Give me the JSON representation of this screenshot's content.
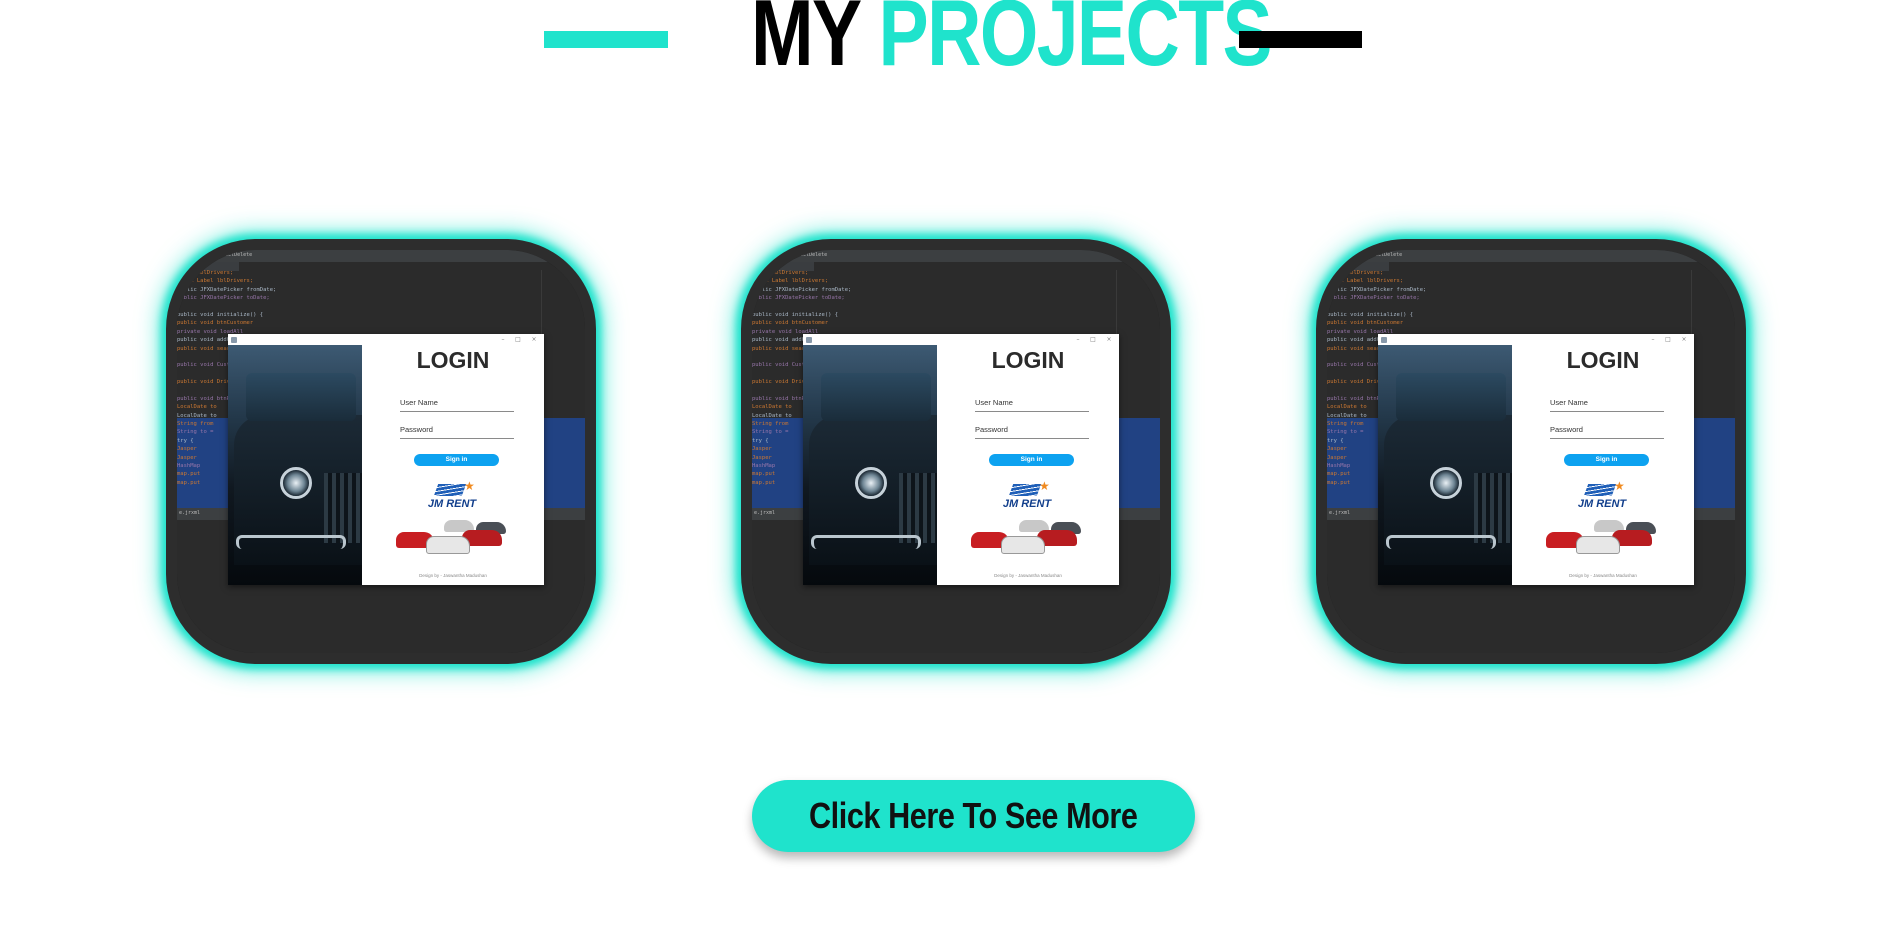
{
  "colors": {
    "accent": "#1fe3cc",
    "dark": "#000000",
    "card_glow": "#1fe3cc",
    "button_bg": "#1fe3cc",
    "signin_blue": "#0da2f0"
  },
  "header": {
    "title_prefix": "MY",
    "title_highlight": "PROJECTS"
  },
  "projects": [
    {
      "editor_tab": "inspectDelete",
      "login_title": "LOGIN",
      "username_label": "User Name",
      "password_label": "Password",
      "signin_label": "Sign in",
      "logo_text": "JM RENT",
      "footer_text": "Design by - Jaswantha Madushan"
    },
    {
      "editor_tab": "inspectDelete",
      "login_title": "LOGIN",
      "username_label": "User Name",
      "password_label": "Password",
      "signin_label": "Sign in",
      "logo_text": "JM RENT",
      "footer_text": "Design by - Jaswantha Madushan"
    },
    {
      "editor_tab": "inspectDelete",
      "login_title": "LOGIN",
      "username_label": "User Name",
      "password_label": "Password",
      "signin_label": "Sign in",
      "logo_text": "JM RENT",
      "footer_text": "Design by - Jaswantha Madushan"
    }
  ],
  "code_lines": [
    "  Label lblDrivers;",
    "  @FXML Label lblDrivers;",
    "  public JFXDatePicker fromDate;",
    "  public JFXDatePicker toDate;",
    "",
    "public void initialize() {",
    "public void btnCustomer",
    "private void loadAll",
    "public void addCar",
    "public void search",
    "",
    "public void Customer",
    "",
    "public void Driver",
    "",
    "public void btnReport",
    "    LocalDate to",
    "    LocalDate to",
    "    String from",
    "    String to =",
    "    try {",
    "      Jasper",
    "      Jasper",
    "      HashMap",
    "      map.put",
    "      map.put"
  ],
  "status_text": "e.jrxml",
  "cta": {
    "label": "Click Here To See More"
  }
}
